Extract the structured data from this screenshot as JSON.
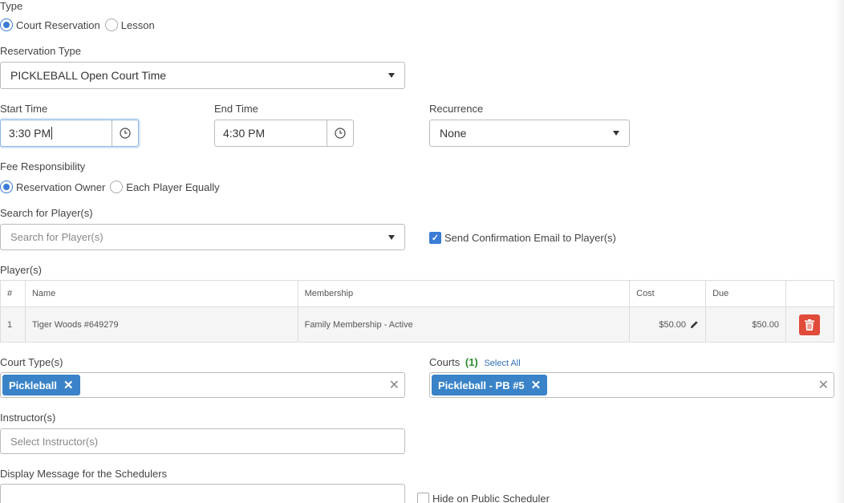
{
  "type": {
    "label": "Type",
    "options": [
      {
        "label": "Court Reservation",
        "selected": true
      },
      {
        "label": "Lesson",
        "selected": false
      }
    ]
  },
  "reservation_type": {
    "label": "Reservation Type",
    "value": "PICKLEBALL Open Court Time"
  },
  "start_time": {
    "label": "Start Time",
    "value": "3:30 PM"
  },
  "end_time": {
    "label": "End Time",
    "value": "4:30 PM"
  },
  "recurrence": {
    "label": "Recurrence",
    "value": "None"
  },
  "fee_responsibility": {
    "label": "Fee Responsibility",
    "options": [
      {
        "label": "Reservation Owner",
        "selected": true
      },
      {
        "label": "Each Player Equally",
        "selected": false
      }
    ]
  },
  "search_players": {
    "label": "Search for Player(s)",
    "placeholder": "Search for Player(s)"
  },
  "send_confirmation": {
    "label": "Send Confirmation Email to Player(s)",
    "checked": true
  },
  "players": {
    "label": "Player(s)",
    "columns": [
      "#",
      "Name",
      "Membership",
      "Cost",
      "Due",
      ""
    ],
    "rows": [
      {
        "num": "1",
        "name": "Tiger Woods #649279",
        "membership": "Family Membership - Active",
        "cost": "$50.00",
        "due": "$50.00"
      }
    ]
  },
  "court_types": {
    "label": "Court Type(s)",
    "tags": [
      "Pickleball"
    ]
  },
  "courts": {
    "label": "Courts",
    "count": "(1)",
    "select_all": "Select All",
    "tags": [
      "Pickleball - PB #5"
    ]
  },
  "instructors": {
    "label": "Instructor(s)",
    "placeholder": "Select Instructor(s)"
  },
  "display_message": {
    "label": "Display Message for the Schedulers"
  },
  "hide_public": {
    "label": "Hide on Public Scheduler",
    "checked": false
  },
  "colors": {
    "accent": "#3a7bd5",
    "tag": "#3a83c8",
    "danger": "#e04b3a",
    "success": "#2e8b2e"
  }
}
